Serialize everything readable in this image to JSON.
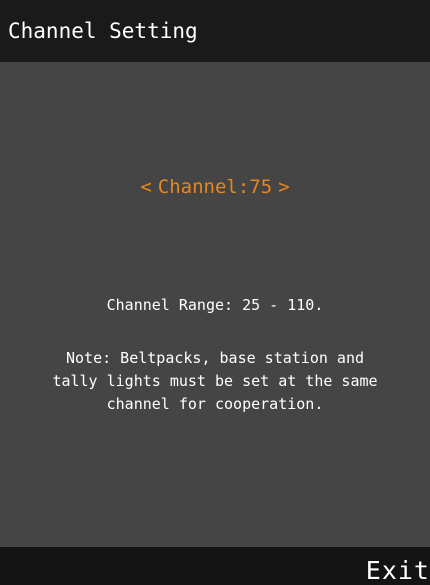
{
  "header": {
    "title": "Channel Setting"
  },
  "channel": {
    "left_arrow": "<",
    "label": "Channel:75",
    "right_arrow": ">",
    "value": 75
  },
  "info": {
    "range": "Channel Range: 25 - 110.",
    "note": "Note: Beltpacks, base station and tally lights must be set at the same channel for cooperation."
  },
  "footer": {
    "exit_label": "Exit"
  },
  "colors": {
    "accent": "#e8861f",
    "background": "#454545",
    "bar": "#1a1a1a"
  }
}
